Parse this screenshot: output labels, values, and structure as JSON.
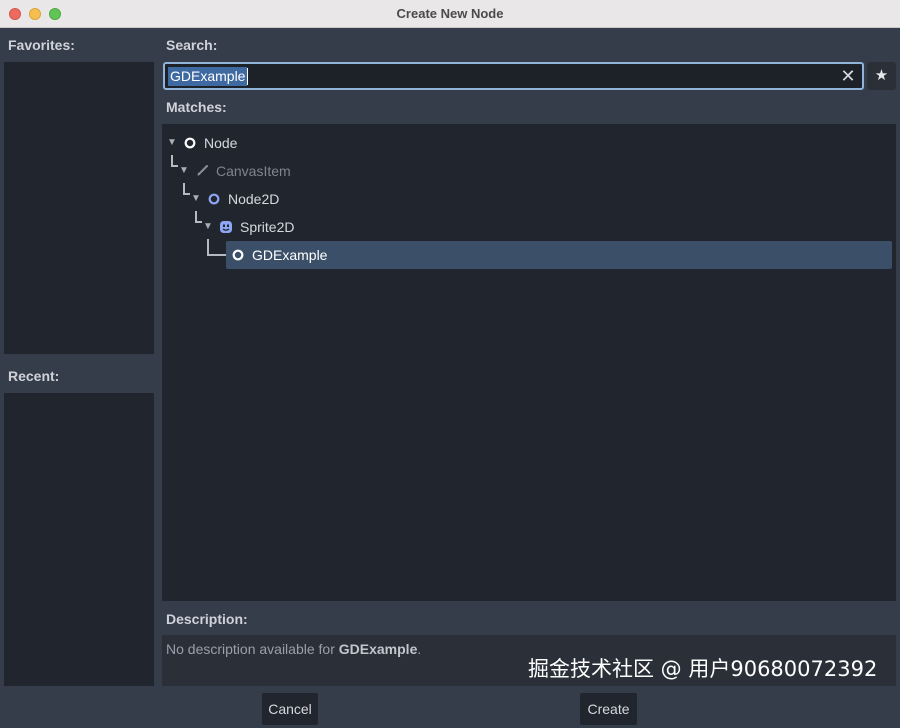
{
  "window": {
    "title": "Create New Node"
  },
  "favorites": {
    "label": "Favorites:"
  },
  "recent": {
    "label": "Recent:"
  },
  "search": {
    "label": "Search:",
    "value": "GDExample",
    "clear_icon": "close-icon",
    "favorite_icon": "star-icon"
  },
  "matches": {
    "label": "Matches:",
    "tree": [
      {
        "label": "Node",
        "icon": "node-circle-icon",
        "expanded": true,
        "depth": 0,
        "disabled": false
      },
      {
        "label": "CanvasItem",
        "icon": "brush-icon",
        "expanded": true,
        "depth": 1,
        "disabled": true
      },
      {
        "label": "Node2D",
        "icon": "node2d-circle-icon",
        "expanded": true,
        "depth": 2,
        "disabled": false
      },
      {
        "label": "Sprite2D",
        "icon": "sprite2d-icon",
        "expanded": true,
        "depth": 3,
        "disabled": false
      },
      {
        "label": "GDExample",
        "icon": "node-circle-icon",
        "expanded": false,
        "depth": 4,
        "disabled": false,
        "selected": true
      }
    ]
  },
  "description": {
    "label": "Description:",
    "prefix": "No description available for ",
    "class_name": "GDExample",
    "suffix": "."
  },
  "buttons": {
    "cancel": "Cancel",
    "create": "Create"
  },
  "watermark": "掘金技术社区 @ 用户90680072392",
  "colors": {
    "background": "#363d4a",
    "panel": "#21252d",
    "selection": "#3b5068",
    "accent_border": "#8fb3d9",
    "node2d_blue": "#8da5f3"
  }
}
